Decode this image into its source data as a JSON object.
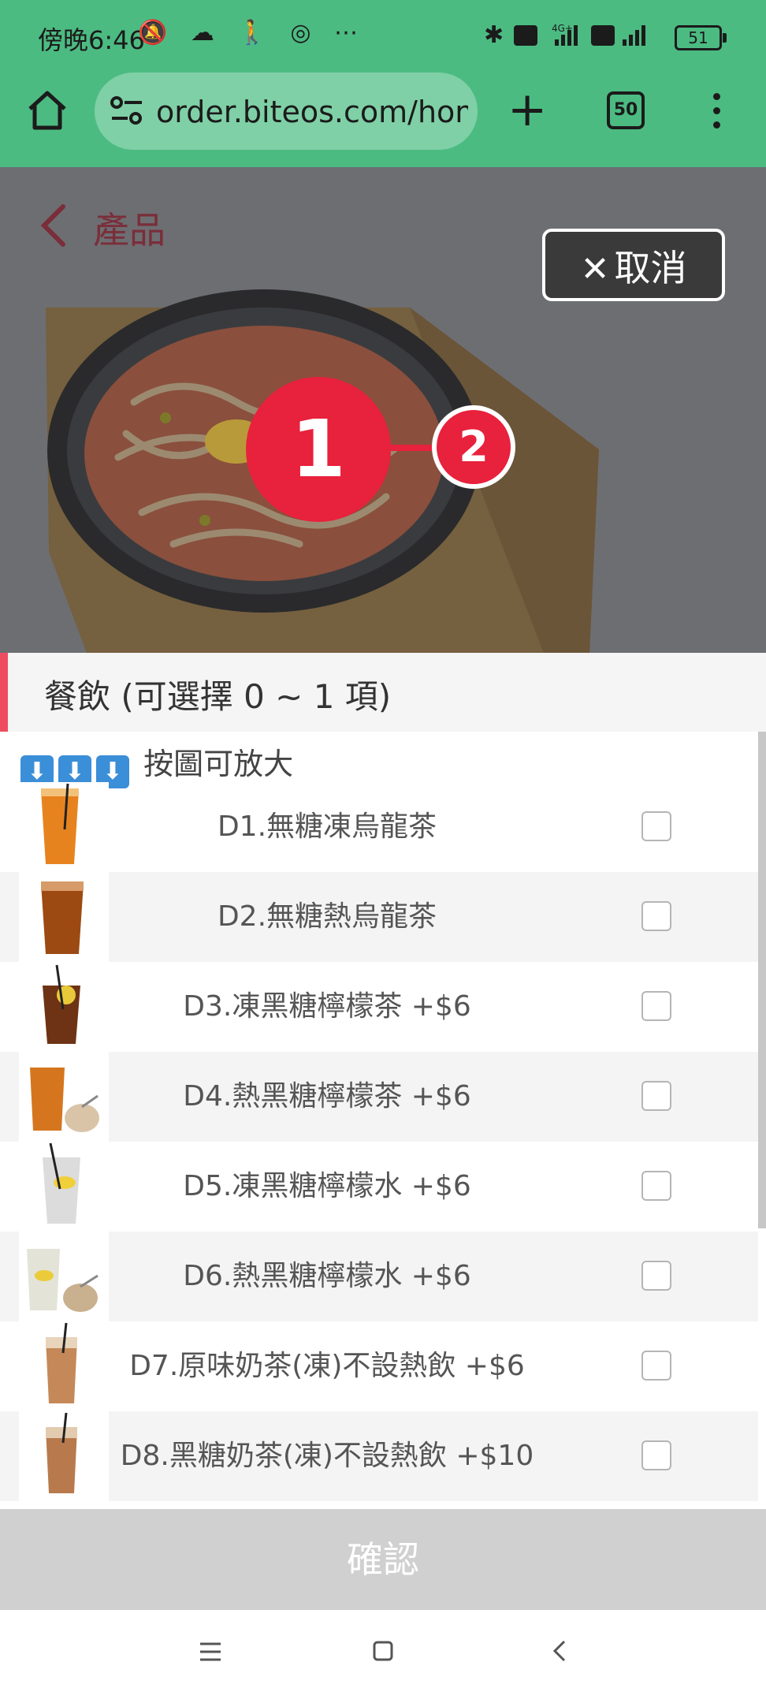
{
  "status_bar": {
    "time": "傍晚6:46",
    "left_icons": "🔕 ☁ 🚶 ◎ ⋯",
    "network": "4G+",
    "battery": "51"
  },
  "browser": {
    "url": "order.biteos.com/hom",
    "tab_count": "50"
  },
  "header": {
    "title": "產品",
    "cancel_label": "取消"
  },
  "markers": {
    "m1": "1",
    "m2": "2"
  },
  "section": {
    "title": "餐飲 (可選擇 0 ~ 1 項)",
    "hint": "按圖可放大"
  },
  "items": [
    {
      "label": "D1.無糖凍烏龍茶",
      "checked": false
    },
    {
      "label": "D2.無糖熱烏龍茶",
      "checked": false
    },
    {
      "label": "D3.凍黑糖檸檬茶 +$6",
      "checked": false
    },
    {
      "label": "D4.熱黑糖檸檬茶 +$6",
      "checked": false
    },
    {
      "label": "D5.凍黑糖檸檬水 +$6",
      "checked": false
    },
    {
      "label": "D6.熱黑糖檸檬水 +$6",
      "checked": false
    },
    {
      "label": "D7.原味奶茶(凍)不設熱飲 +$6",
      "checked": false
    },
    {
      "label": "D8.黑糖奶茶(凍)不設熱飲 +$10",
      "checked": false
    }
  ],
  "confirm_label": "確認",
  "colors": {
    "browser_green": "#4cbb82",
    "accent_red": "#e8213c",
    "dim_overlay": "#6d6e72"
  }
}
